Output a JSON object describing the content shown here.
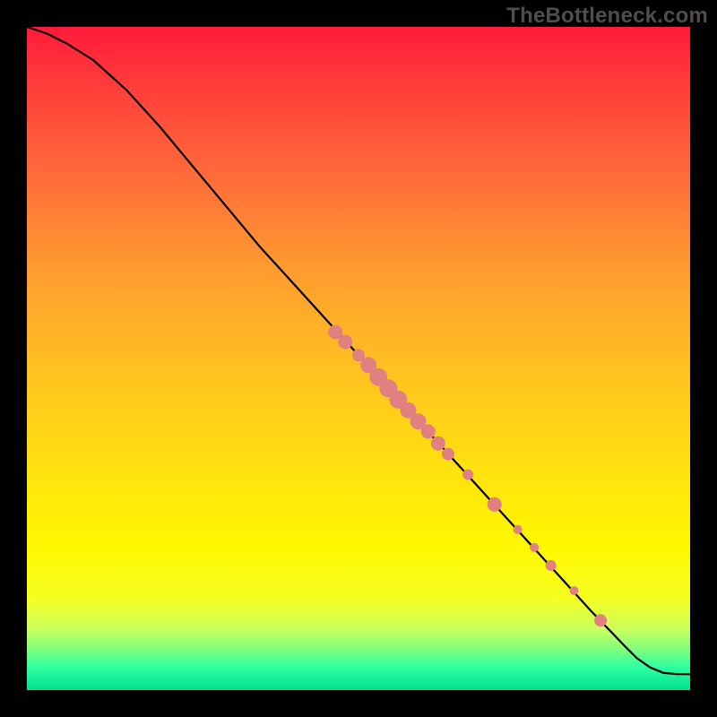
{
  "watermark": "TheBottleneck.com",
  "colors": {
    "page_bg": "#000000",
    "curve": "#000000",
    "dot_fill": "#e08080",
    "gradient_top": "#ff1a3a",
    "gradient_mid": "#ffe010",
    "gradient_bottom": "#00e090"
  },
  "chart_data": {
    "type": "line",
    "title": "",
    "xlabel": "",
    "ylabel": "",
    "xlim": [
      0,
      100
    ],
    "ylim": [
      0,
      100
    ],
    "grid": false,
    "legend": false,
    "series": [
      {
        "name": "curve",
        "x": [
          0,
          3,
          6,
          10,
          15,
          20,
          25,
          30,
          35,
          40,
          45,
          50,
          55,
          60,
          65,
          70,
          75,
          80,
          85,
          90,
          92,
          94,
          96,
          98,
          100
        ],
        "y": [
          100,
          99,
          97.5,
          95,
          90.5,
          85,
          79,
          73,
          67,
          61.5,
          56,
          50.5,
          45,
          39.5,
          34,
          28.5,
          23,
          17.5,
          12,
          6.8,
          4.8,
          3.4,
          2.6,
          2.4,
          2.4
        ]
      }
    ],
    "points": [
      {
        "x": 46.5,
        "y": 54.0,
        "r": 8
      },
      {
        "x": 48.0,
        "y": 52.5,
        "r": 8
      },
      {
        "x": 50.0,
        "y": 50.5,
        "r": 7
      },
      {
        "x": 51.5,
        "y": 49.0,
        "r": 9
      },
      {
        "x": 53.0,
        "y": 47.2,
        "r": 10
      },
      {
        "x": 54.5,
        "y": 45.5,
        "r": 10
      },
      {
        "x": 56.0,
        "y": 43.8,
        "r": 10
      },
      {
        "x": 57.5,
        "y": 42.2,
        "r": 9
      },
      {
        "x": 59.0,
        "y": 40.5,
        "r": 9
      },
      {
        "x": 60.5,
        "y": 39.0,
        "r": 8
      },
      {
        "x": 62.0,
        "y": 37.2,
        "r": 8
      },
      {
        "x": 63.5,
        "y": 35.6,
        "r": 7
      },
      {
        "x": 66.5,
        "y": 32.5,
        "r": 6
      },
      {
        "x": 70.5,
        "y": 28.0,
        "r": 8
      },
      {
        "x": 74.0,
        "y": 24.2,
        "r": 5
      },
      {
        "x": 76.5,
        "y": 21.5,
        "r": 5
      },
      {
        "x": 79.0,
        "y": 18.8,
        "r": 6
      },
      {
        "x": 82.5,
        "y": 15.0,
        "r": 5
      },
      {
        "x": 86.5,
        "y": 10.5,
        "r": 7
      }
    ]
  }
}
